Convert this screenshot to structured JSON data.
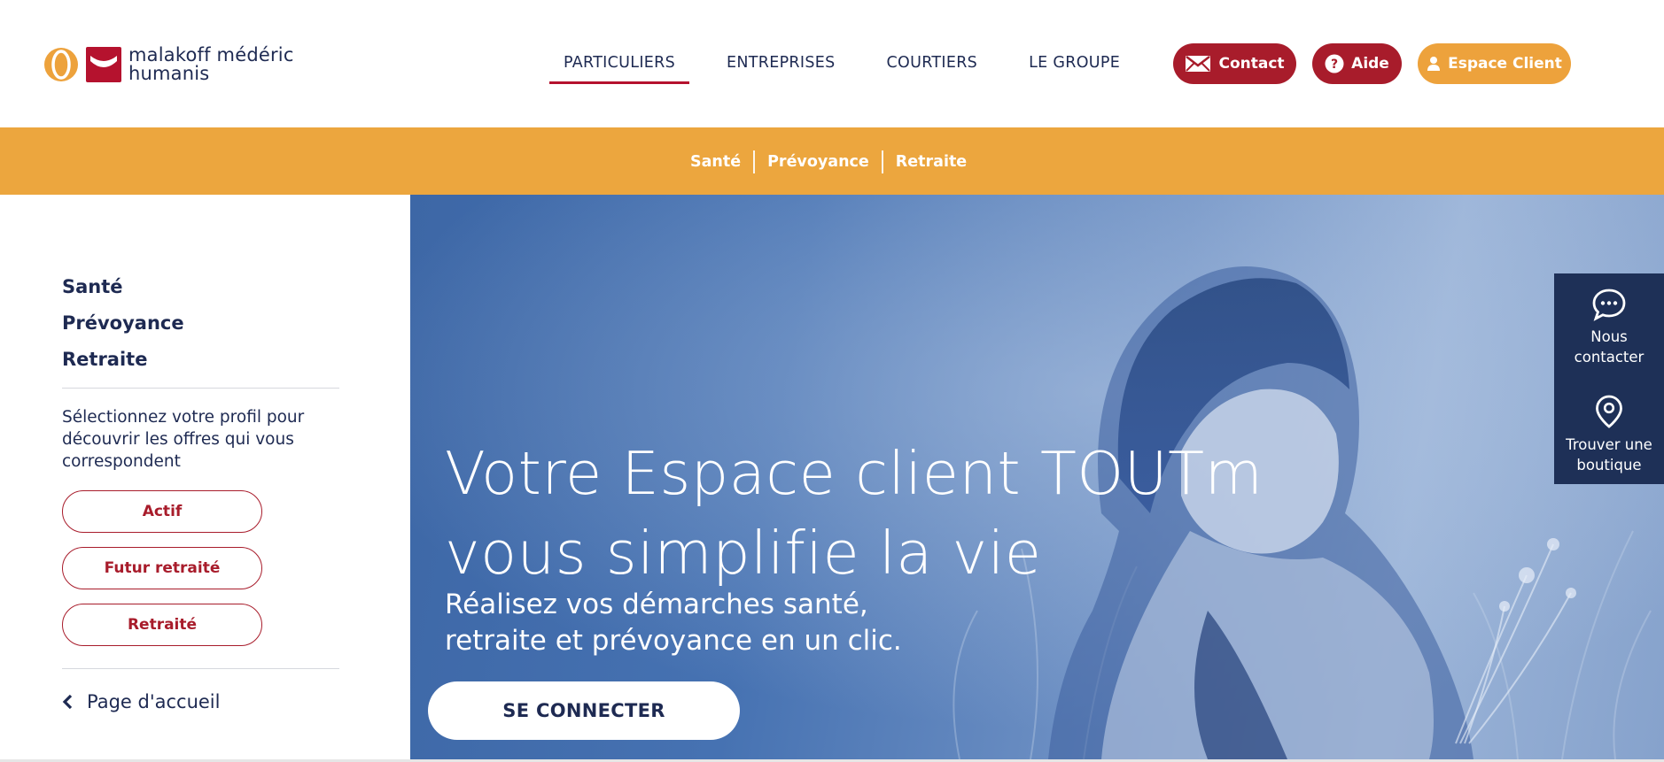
{
  "brand": {
    "logo_line1": "malakoff médéric",
    "logo_line2": "humanis",
    "colors": {
      "navy": "#1e2a52",
      "red": "#a81c2b",
      "orange": "#eca63e",
      "hero_blue": "#4672b2",
      "panel": "#1e3057"
    }
  },
  "header": {
    "nav": [
      {
        "label": "PARTICULIERS",
        "active": true
      },
      {
        "label": "ENTREPRISES",
        "active": false
      },
      {
        "label": "COURTIERS",
        "active": false
      },
      {
        "label": "LE GROUPE",
        "active": false
      }
    ],
    "contact_label": "Contact",
    "aide_label": "Aide",
    "espace_label": "Espace Client"
  },
  "subnav": {
    "items": [
      "Santé",
      "Prévoyance",
      "Retraite"
    ]
  },
  "sidebar": {
    "links": [
      "Santé",
      "Prévoyance",
      "Retraite"
    ],
    "description": "Sélectionnez votre profil pour découvrir les offres qui vous correspondent",
    "profiles": [
      "Actif",
      "Futur retraité",
      "Retraité"
    ],
    "home_label": "Page d'accueil"
  },
  "hero": {
    "title_line1": "Votre Espace client TOUTm",
    "title_line2": "vous simplifie la vie",
    "subtitle_line1": "Réalisez vos démarches santé,",
    "subtitle_line2": "retraite et prévoyance en un clic.",
    "cta_label": "SE CONNECTER"
  },
  "float_panel": {
    "contact_line1": "Nous",
    "contact_line2": "contacter",
    "store_line1": "Trouver une",
    "store_line2": "boutique",
    "icons": [
      "chat-bubble-icon",
      "map-pin-icon"
    ]
  }
}
